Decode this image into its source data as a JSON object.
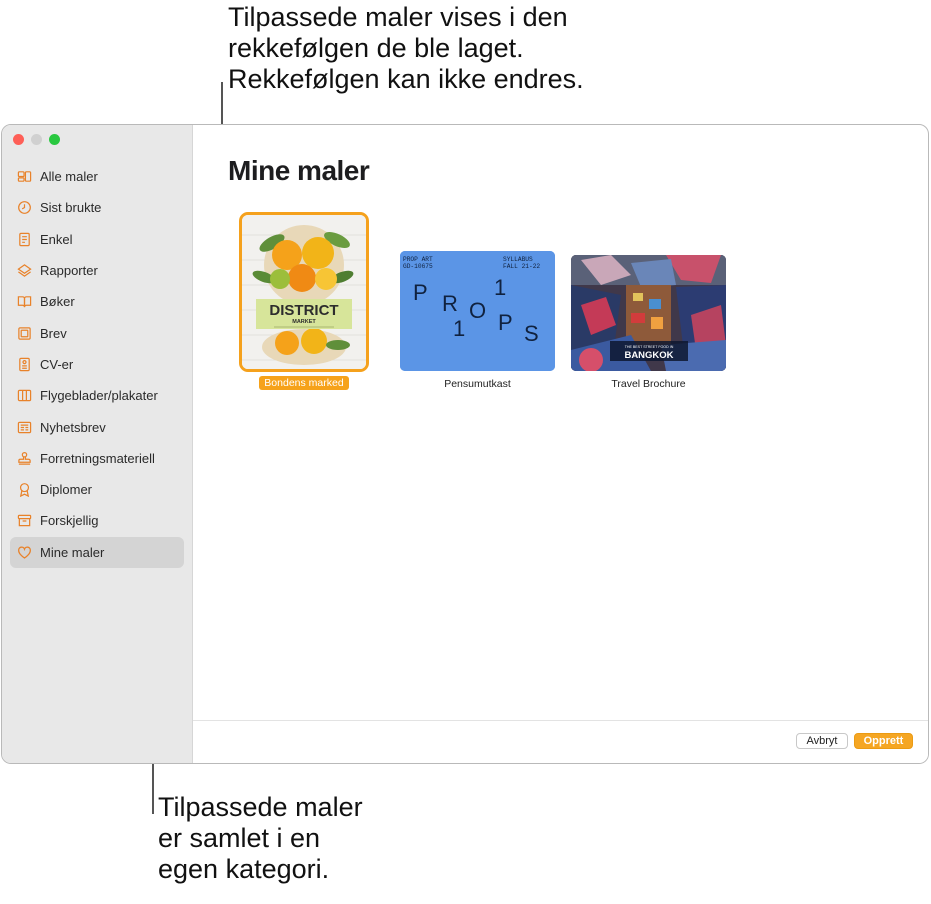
{
  "callouts": {
    "top": [
      "Tilpassede maler vises i den",
      "rekkefølgen de ble laget.",
      "Rekkefølgen kan ikke endres."
    ],
    "bottom": [
      "Tilpassede maler",
      "er samlet i en",
      "egen kategori."
    ]
  },
  "sidebar": {
    "items": [
      {
        "label": "Alle maler",
        "icon": "all-templates-icon"
      },
      {
        "label": "Sist brukte",
        "icon": "clock-icon"
      },
      {
        "label": "Enkel",
        "icon": "document-icon"
      },
      {
        "label": "Rapporter",
        "icon": "reports-icon"
      },
      {
        "label": "Bøker",
        "icon": "book-icon"
      },
      {
        "label": "Brev",
        "icon": "letter-icon"
      },
      {
        "label": "CV-er",
        "icon": "resume-icon"
      },
      {
        "label": "Flygeblader/plakater",
        "icon": "flyer-icon"
      },
      {
        "label": "Nyhetsbrev",
        "icon": "newsletter-icon"
      },
      {
        "label": "Forretningsmateriell",
        "icon": "stamp-icon"
      },
      {
        "label": "Diplomer",
        "icon": "ribbon-icon"
      },
      {
        "label": "Forskjellig",
        "icon": "archive-box-icon"
      },
      {
        "label": "Mine maler",
        "icon": "heart-icon",
        "active": true
      }
    ]
  },
  "main": {
    "title": "Mine maler",
    "templates": [
      {
        "label": "Bondens marked",
        "selected": true,
        "cover_title": "DISTRICT",
        "cover_subtitle": "MARKET"
      },
      {
        "label": "Pensumutkast",
        "selected": false,
        "cover_top_left": [
          "PROP ART",
          "GD-10675"
        ],
        "cover_top_right": [
          "SYLLABUS",
          "FALL 21-22"
        ],
        "cover_letters": [
          "P",
          "R",
          "O",
          "1",
          "1",
          "O",
          "P",
          "S"
        ]
      },
      {
        "label": "Travel Brochure",
        "selected": false,
        "cover_small": "THE BEST STREET FOOD IN",
        "cover_title": "BANGKOK"
      }
    ]
  },
  "footer": {
    "cancel_label": "Avbryt",
    "create_label": "Opprett"
  },
  "colors": {
    "accent": "#f5a623",
    "sidebar_bg": "#e8e8e8",
    "syllabus_blue": "#5b95e6"
  }
}
